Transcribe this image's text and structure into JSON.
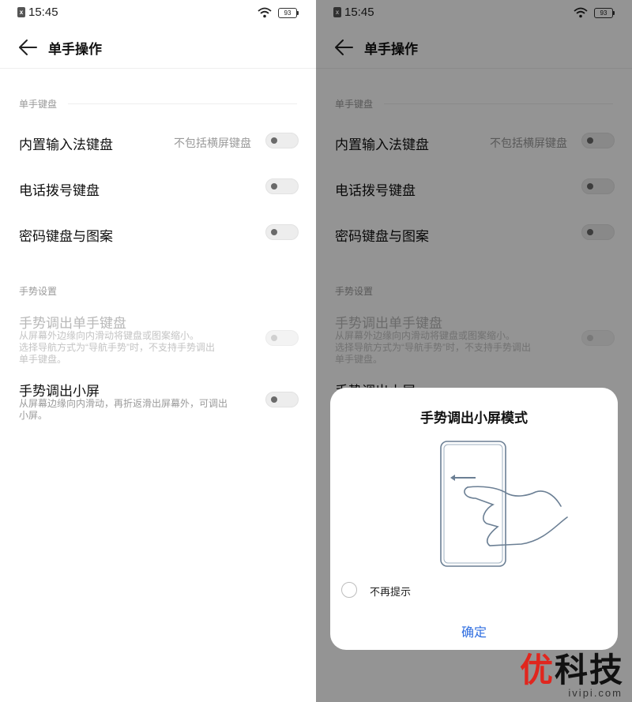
{
  "status_bar": {
    "time": "15:45",
    "battery": "93"
  },
  "header": {
    "title": "单手操作"
  },
  "sections": {
    "keyboard": {
      "label": "单手键盘"
    },
    "gesture": {
      "label": "手势设置"
    }
  },
  "rows": {
    "builtin_ime": {
      "title": "内置输入法键盘",
      "value": "不包括横屏键盘"
    },
    "dialer": {
      "title": "电话拨号键盘"
    },
    "password": {
      "title": "密码键盘与图案"
    },
    "gesture_keyboard": {
      "title": "手势调出单手键盘",
      "desc_line1": "从屏幕外边缘向内滑动将键盘或图案缩小。",
      "desc_line2": "选择导航方式为“导航手势”时，不支持手势调出",
      "desc_line3": "单手键盘。"
    },
    "gesture_small_screen": {
      "title": "手势调出小屏",
      "desc_line1": "从屏幕边缘向内滑动，再折返滑出屏幕外，可调出",
      "desc_line2": "小屏。"
    }
  },
  "dialog": {
    "title": "手势调出小屏模式",
    "dont_remind": "不再提示",
    "confirm": "确定"
  },
  "watermark": {
    "main_red": "优",
    "main_rest": "科技",
    "sub": "ivipi.com"
  },
  "colors": {
    "accent": "#2f6ee0",
    "watermark_red": "#e0261e"
  }
}
